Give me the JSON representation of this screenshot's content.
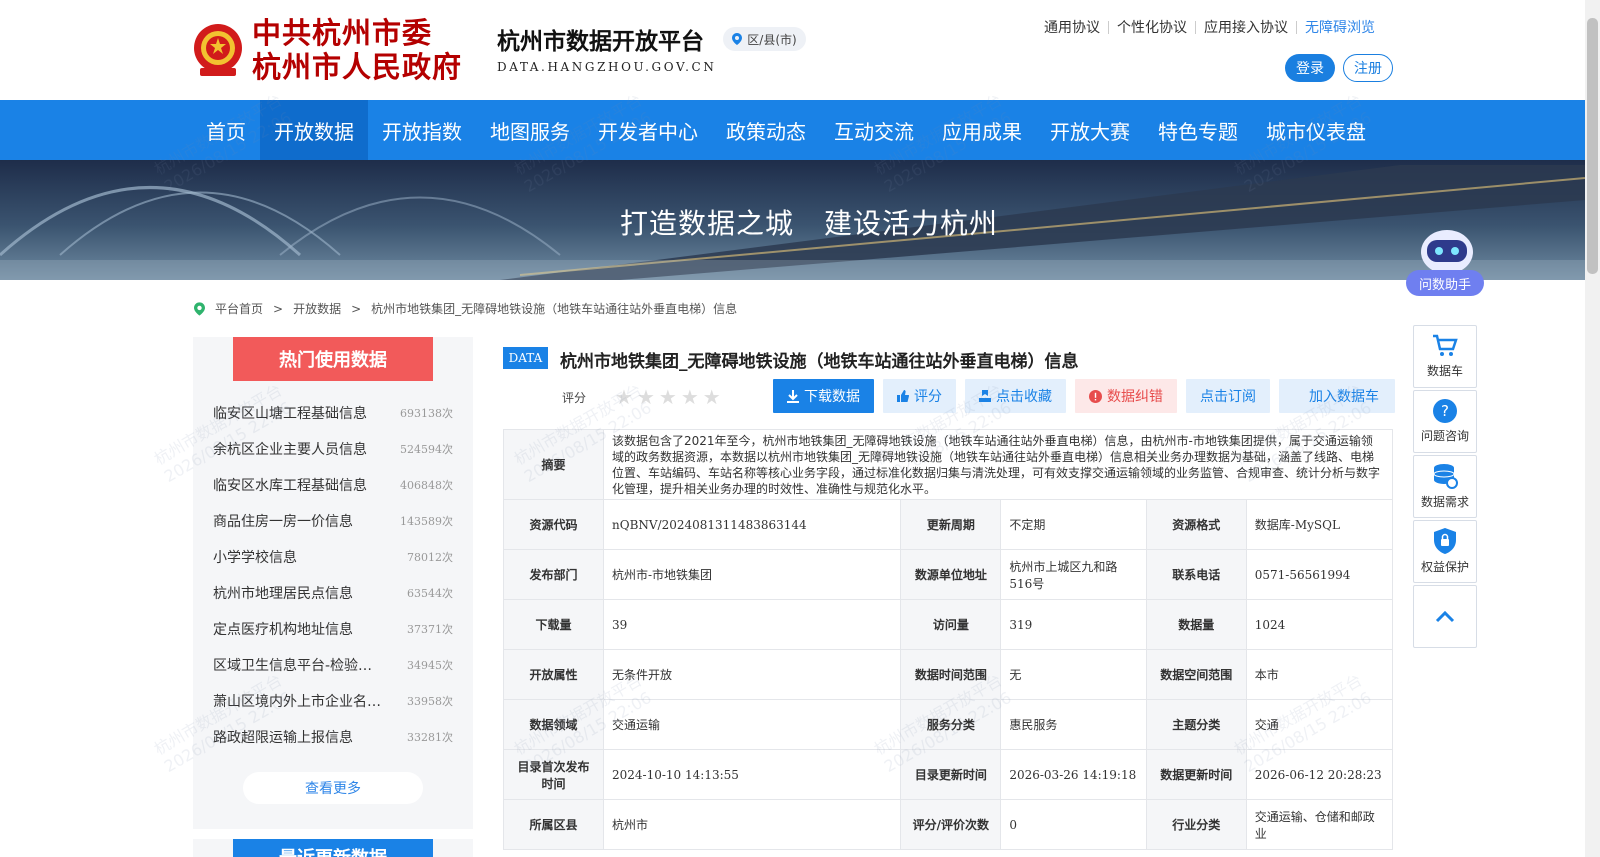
{
  "header": {
    "gov_name_line1": "中共杭州市委",
    "gov_name_line2": "杭州市人民政府",
    "platform_title": "杭州市数据开放平台",
    "platform_url": "DATA.HANGZHOU.GOV.CN",
    "district_label": "区/县(市)",
    "top_links": [
      "通用协议",
      "个性化协议",
      "应用接入协议",
      "无障碍浏览"
    ],
    "login": "登录",
    "register": "注册"
  },
  "nav": {
    "items": [
      "首页",
      "开放数据",
      "开放指数",
      "地图服务",
      "开发者中心",
      "政策动态",
      "互动交流",
      "应用成果",
      "开放大赛",
      "特色专题",
      "城市仪表盘"
    ],
    "active_index": 1
  },
  "banner": {
    "slogan1": "打造数据之城",
    "slogan2": "建设活力杭州"
  },
  "assistant": {
    "label": "问数助手"
  },
  "breadcrumb": {
    "items": [
      "平台首页",
      "开放数据",
      "杭州市地铁集团_无障碍地铁设施（地铁车站通往站外垂直电梯）信息"
    ],
    "separator": ">"
  },
  "sidebar": {
    "hot_title": "热门使用数据",
    "hot_items": [
      {
        "name": "临安区山塘工程基础信息",
        "count": "693138次"
      },
      {
        "name": "余杭区企业主要人员信息",
        "count": "524594次"
      },
      {
        "name": "临安区水库工程基础信息",
        "count": "406848次"
      },
      {
        "name": "商品住房一房一价信息",
        "count": "143589次"
      },
      {
        "name": "小学学校信息",
        "count": "78012次"
      },
      {
        "name": "杭州市地理居民点信息",
        "count": "63544次"
      },
      {
        "name": "定点医疗机构地址信息",
        "count": "37371次"
      },
      {
        "name": "区域卫生信息平台-检验…",
        "count": "34945次"
      },
      {
        "name": "萧山区境内外上市企业名…",
        "count": "33958次"
      },
      {
        "name": "路政超限运输上报信息",
        "count": "33281次"
      }
    ],
    "more": "查看更多",
    "recent_title": "最近更新数据"
  },
  "dataset": {
    "badge": "DATA",
    "title": "杭州市地铁集团_无障碍地铁设施（地铁车站通往站外垂直电梯）信息",
    "rating_label": "评分",
    "rating_value": 0,
    "actions": {
      "download": "下载数据",
      "rate": "评分",
      "favorite": "点击收藏",
      "report": "数据纠错",
      "subscribe": "点击订阅",
      "add_cart": "加入数据车"
    },
    "summary_label": "摘要",
    "summary": "该数据包含了2021年至今，杭州市地铁集团_无障碍地铁设施（地铁车站通往站外垂直电梯）信息，由杭州市-市地铁集团提供，属于交通运输领域的政务数据资源，本数据以杭州市地铁集团_无障碍地铁设施（地铁车站通往站外垂直电梯）信息相关业务办理数据为基础，涵盖了线路、电梯位置、车站编码、车站名称等核心业务字段，通过标准化数据归集与清洗处理，可有效支撑交通运输领域的业务监管、合规审查、统计分析与数字化管理，提升相关业务办理的时效性、准确性与规范化水平。",
    "rows": [
      [
        {
          "k": "资源代码",
          "v": "nQBNV/2024081311483863144"
        },
        {
          "k": "更新周期",
          "v": "不定期"
        },
        {
          "k": "资源格式",
          "v": "数据库-MySQL"
        }
      ],
      [
        {
          "k": "发布部门",
          "v": "杭州市-市地铁集团"
        },
        {
          "k": "数源单位地址",
          "v": "杭州市上城区九和路516号"
        },
        {
          "k": "联系电话",
          "v": "0571-56561994"
        }
      ],
      [
        {
          "k": "下载量",
          "v": "39"
        },
        {
          "k": "访问量",
          "v": "319"
        },
        {
          "k": "数据量",
          "v": "1024"
        }
      ],
      [
        {
          "k": "开放属性",
          "v": "无条件开放"
        },
        {
          "k": "数据时间范围",
          "v": "无"
        },
        {
          "k": "数据空间范围",
          "v": "本市"
        }
      ],
      [
        {
          "k": "数据领域",
          "v": "交通运输"
        },
        {
          "k": "服务分类",
          "v": "惠民服务"
        },
        {
          "k": "主题分类",
          "v": "交通"
        }
      ],
      [
        {
          "k": "目录首次发布时间",
          "v": "2024-10-10 14:13:55"
        },
        {
          "k": "目录更新时间",
          "v": "2026-03-26 14:19:18"
        },
        {
          "k": "数据更新时间",
          "v": "2026-06-12 20:28:23"
        }
      ],
      [
        {
          "k": "所属区县",
          "v": "杭州市"
        },
        {
          "k": "评分/评价次数",
          "v": "0"
        },
        {
          "k": "行业分类",
          "v": "交通运输、仓储和邮政业"
        }
      ]
    ]
  },
  "tools": {
    "items": [
      "数据车",
      "问题咨询",
      "数据需求",
      "权益保护"
    ]
  },
  "watermark": {
    "line1": "杭州市数据开放平台",
    "line2": "2026/08/15 22:06"
  },
  "colors": {
    "primary": "#1a82e6",
    "nav_active": "#0f6ccc",
    "hot_title": "#f25a5a",
    "gov_red": "#b40000"
  }
}
